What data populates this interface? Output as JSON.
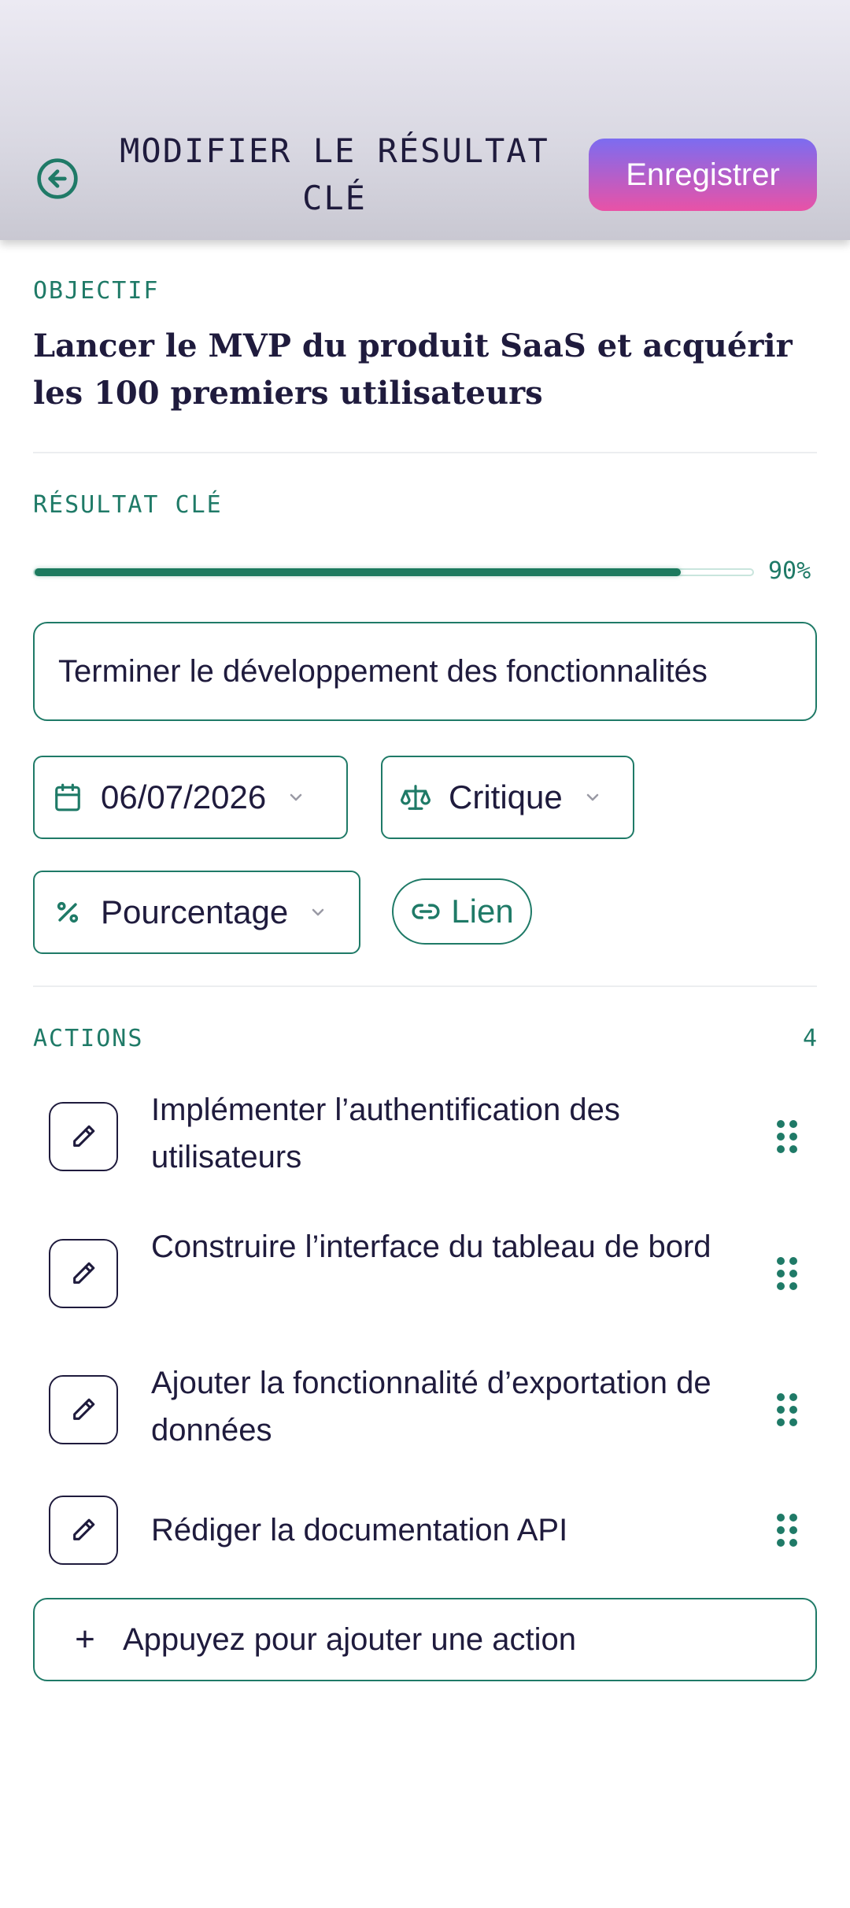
{
  "header": {
    "title": "MODIFIER LE RÉSULTAT CLÉ",
    "save_label": "Enregistrer"
  },
  "objective": {
    "label": "OBJECTIF",
    "text": "Lancer le MVP du produit SaaS et acquérir les 100 premiers utilisateurs"
  },
  "key_result": {
    "label": "RÉSULTAT CLÉ",
    "progress_percent": 90,
    "progress_label": "90%",
    "title_value": "Terminer le développement des fonctionnalités",
    "due_date": "06/07/2026",
    "priority": "Critique",
    "measure_type": "Pourcentage",
    "link_label": "Lien"
  },
  "actions": {
    "label": "ACTIONS",
    "count": "4",
    "items": [
      {
        "text": "Implémenter l’authentification des utilisateurs"
      },
      {
        "text": "Construire l’interface du tableau de bord"
      },
      {
        "text": "Ajouter la fonctionnalité d’exportation de données"
      },
      {
        "text": "Rédiger la documentation API"
      }
    ],
    "add_label": "Appuyez pour ajouter une action"
  },
  "colors": {
    "accent": "#1f7a67",
    "text": "#1f1b3d",
    "save_gradient_start": "#7c6cf0",
    "save_gradient_end": "#e952a6"
  },
  "icons": {
    "back": "arrow-left-circle-icon",
    "calendar": "calendar-icon",
    "priority": "scale-icon",
    "percent": "percent-icon",
    "link": "link-icon",
    "edit": "pencil-icon",
    "drag": "drag-handle-icon",
    "add": "plus-icon"
  }
}
